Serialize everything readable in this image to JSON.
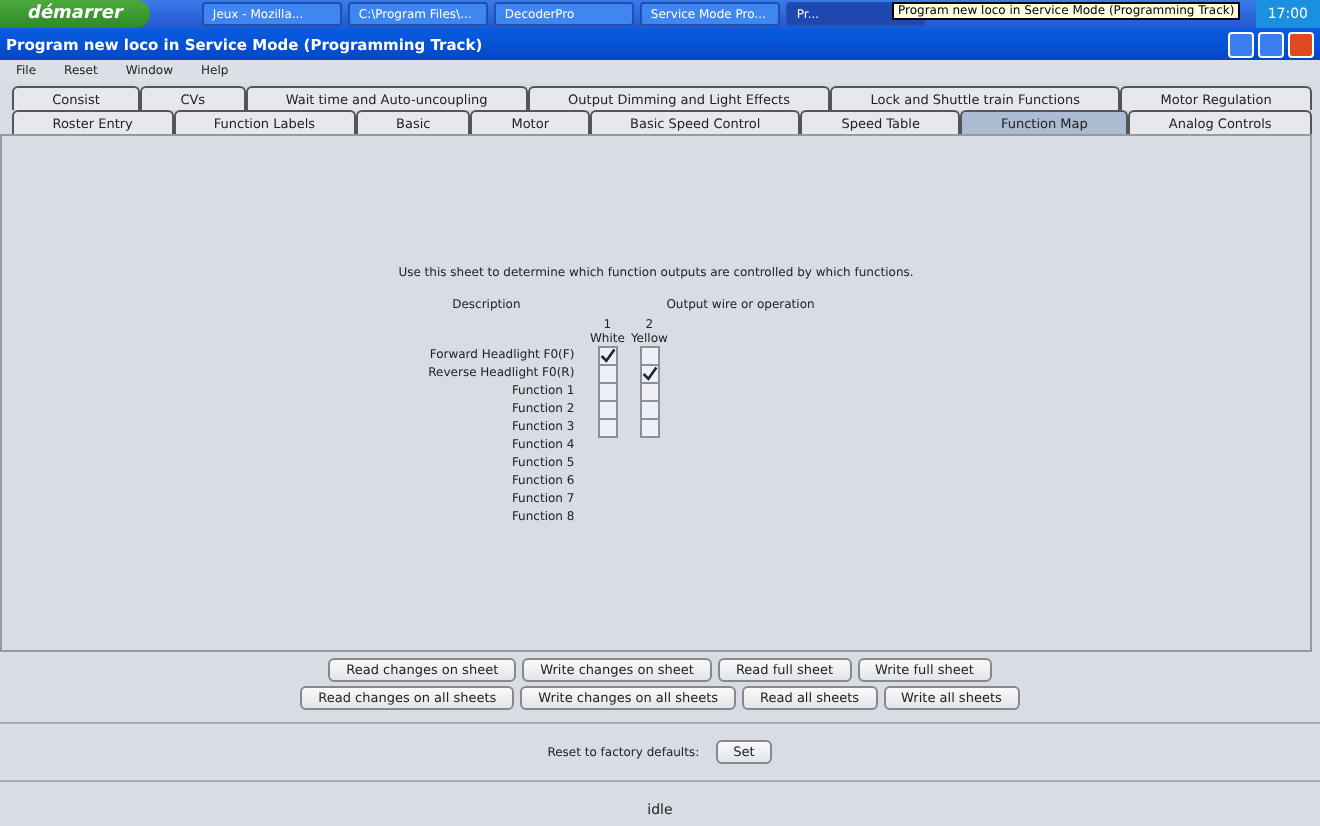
{
  "taskbar": {
    "start": "démarrer",
    "tasks": [
      {
        "label": "Jeux - Mozilla...",
        "selected": false
      },
      {
        "label": "C:\\Program Files\\...",
        "selected": false
      },
      {
        "label": "DecoderPro",
        "selected": false
      },
      {
        "label": "Service Mode Pro...",
        "selected": false
      },
      {
        "label": "Pr...",
        "selected": true
      }
    ],
    "tooltip": "Program new loco in Service Mode (Programming Track)",
    "clock": "17:00"
  },
  "window": {
    "title": "Program new loco in Service Mode (Programming Track)"
  },
  "menu": [
    "File",
    "Reset",
    "Window",
    "Help"
  ],
  "tab_rows": [
    [
      {
        "label": "Consist",
        "selected": false
      },
      {
        "label": "CVs",
        "selected": false
      },
      {
        "label": "Wait time and Auto-uncoupling",
        "selected": false
      },
      {
        "label": "Output Dimming and Light Effects",
        "selected": false
      },
      {
        "label": "Lock and Shuttle train Functions",
        "selected": false
      },
      {
        "label": "Motor Regulation",
        "selected": false
      }
    ],
    [
      {
        "label": "Roster Entry",
        "selected": false
      },
      {
        "label": "Function Labels",
        "selected": false
      },
      {
        "label": "Basic",
        "selected": false
      },
      {
        "label": "Motor",
        "selected": false
      },
      {
        "label": "Basic Speed Control",
        "selected": false
      },
      {
        "label": "Speed Table",
        "selected": false
      },
      {
        "label": "Function Map",
        "selected": true
      },
      {
        "label": "Analog Controls",
        "selected": false
      }
    ]
  ],
  "function_map": {
    "intro": "Use this sheet to determine which function outputs are controlled by which functions.",
    "description_header": "Description",
    "outputs_header": "Output wire or operation",
    "outputs": [
      {
        "number": "1",
        "name": "White"
      },
      {
        "number": "2",
        "name": "Yellow"
      }
    ],
    "rows": [
      {
        "label": "Forward Headlight F0(F)",
        "outputs": [
          {
            "checked": true
          },
          {
            "checked": false
          }
        ]
      },
      {
        "label": "Reverse Headlight F0(R)",
        "outputs": [
          {
            "checked": false
          },
          {
            "checked": true
          }
        ]
      },
      {
        "label": "Function 1",
        "outputs": [
          {
            "checked": false
          },
          {
            "checked": false
          }
        ]
      },
      {
        "label": "Function 2",
        "outputs": [
          {
            "checked": false
          },
          {
            "checked": false
          }
        ]
      },
      {
        "label": "Function 3",
        "outputs": [
          {
            "checked": false
          },
          {
            "checked": false
          }
        ]
      },
      {
        "label": "Function 4",
        "outputs": []
      },
      {
        "label": "Function 5",
        "outputs": []
      },
      {
        "label": "Function 6",
        "outputs": []
      },
      {
        "label": "Function 7",
        "outputs": []
      },
      {
        "label": "Function 8",
        "outputs": []
      }
    ]
  },
  "buttons": [
    [
      "Read changes on sheet",
      "Write changes on sheet",
      "Read full sheet",
      "Write full sheet"
    ],
    [
      "Read changes on all sheets",
      "Write changes on all sheets",
      "Read all sheets",
      "Write all sheets"
    ]
  ],
  "reset": {
    "label": "Reset to factory defaults:",
    "button": "Set"
  },
  "status_bar": "idle"
}
